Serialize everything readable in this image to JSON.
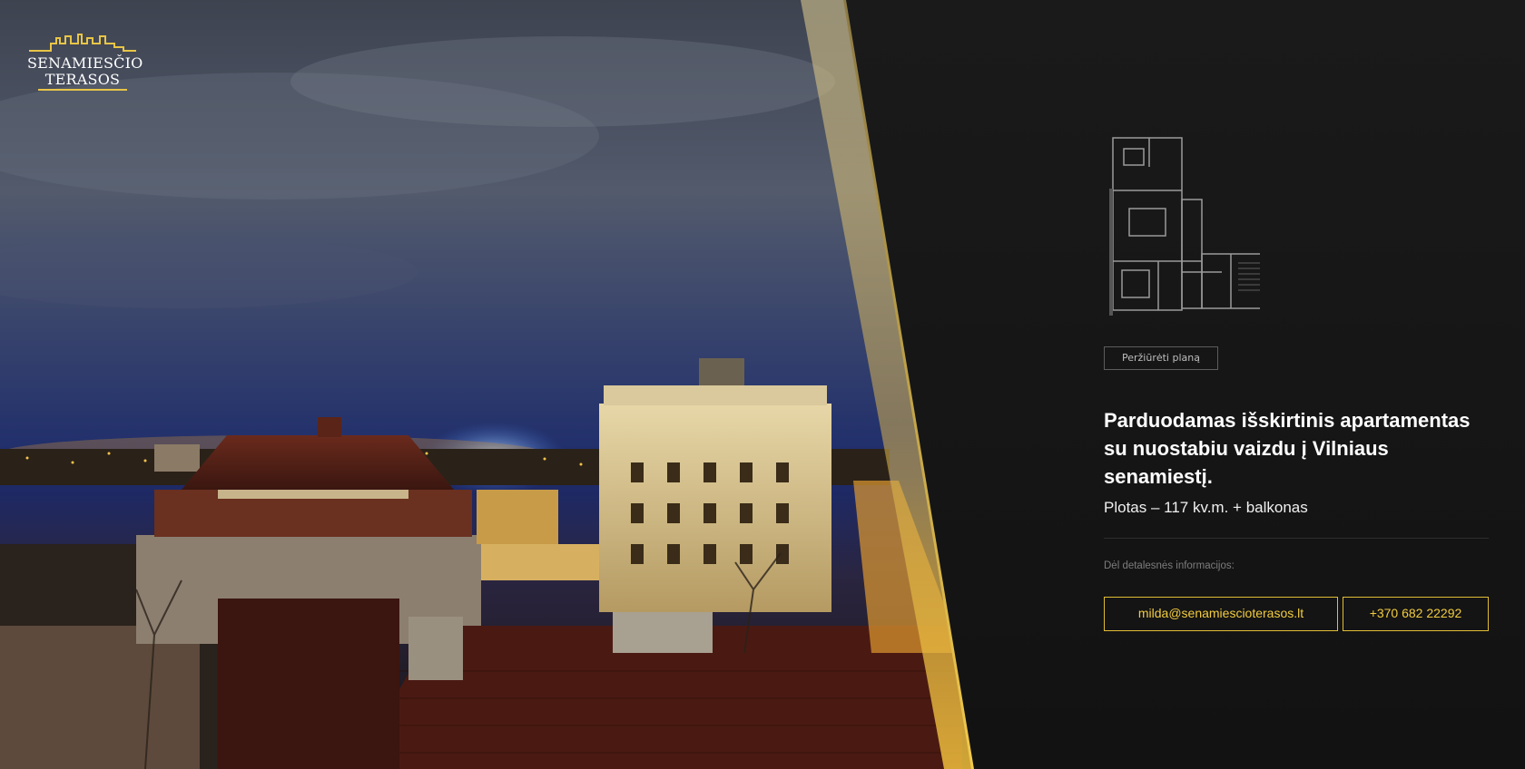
{
  "brand": {
    "line1": "SENAMIESČIO",
    "line2": "TERASOS",
    "accent": "#e8c547"
  },
  "hero_image": {
    "icon": "vilnius-night-cityscape-photo"
  },
  "plan": {
    "icon": "floor-plan-icon",
    "button_label": "Peržiūrėti planą"
  },
  "listing": {
    "headline_part1": "Parduodamas išskirtinis apartamentas su nuostabiu vaizdu į ",
    "headline_bold": "Vilniaus senamiestį",
    "headline_end": ".",
    "area": "Plotas – 117 kv.m. + balkonas"
  },
  "contact": {
    "label": "Dėl detalesnės informacijos:",
    "email": "milda@senamiescioterasos.lt",
    "phone": "+370 682 22292",
    "accent": "#e2bd35"
  }
}
